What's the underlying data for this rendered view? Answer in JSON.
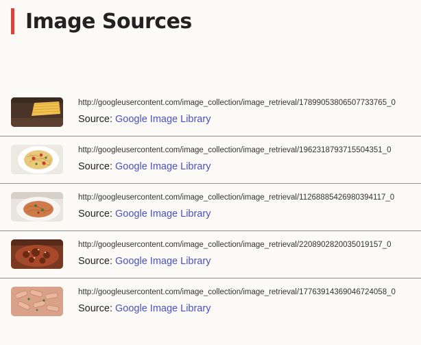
{
  "page": {
    "title": "Image Sources"
  },
  "colors": {
    "accent": "#d9443a",
    "link": "#4a4fc2",
    "divider": "#8f8f8f"
  },
  "sources": [
    {
      "url": "http://googleusercontent.com/image_collection/image_retrieval/17899053806507733765_0",
      "source_label": "Source:",
      "source_link": "Google Image Library",
      "thumbnail": "dry-spaghetti-on-wood"
    },
    {
      "url": "http://googleusercontent.com/image_collection/image_retrieval/1962318793715504351_0",
      "source_label": "Source:",
      "source_link": "Google Image Library",
      "thumbnail": "pasta-with-tomatoes-plate"
    },
    {
      "url": "http://googleusercontent.com/image_collection/image_retrieval/11268885426980394117_0",
      "source_label": "Source:",
      "source_link": "Google Image Library",
      "thumbnail": "pasta-bowl-with-herbs"
    },
    {
      "url": "http://googleusercontent.com/image_collection/image_retrieval/2208902820035019157_0",
      "source_label": "Source:",
      "source_link": "Google Image Library",
      "thumbnail": "spaghetti-meat-sauce"
    },
    {
      "url": "http://googleusercontent.com/image_collection/image_retrieval/17763914369046724058_0",
      "source_label": "Source:",
      "source_link": "Google Image Library",
      "thumbnail": "penne-tomato-cream"
    }
  ]
}
